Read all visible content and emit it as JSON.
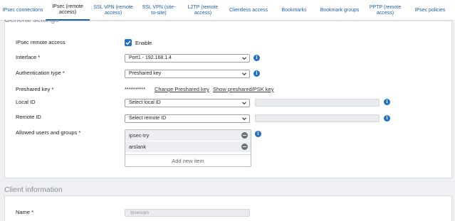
{
  "tabs": [
    {
      "label": "IPsec connections"
    },
    {
      "label": "IPsec (remote access)",
      "active": true
    },
    {
      "label": "SSL VPN (remote access)"
    },
    {
      "label": "SSL VPN (site-to-site)"
    },
    {
      "label": "L2TP (remote access)"
    },
    {
      "label": "Clientless access"
    },
    {
      "label": "Bookmarks"
    },
    {
      "label": "Bookmark groups"
    },
    {
      "label": "PPTP (remote access)"
    },
    {
      "label": "IPsec policies"
    }
  ],
  "general": {
    "section_title": "General settings",
    "ipsec_label": "IPsec remote access",
    "enable_label": "Enable",
    "enable_checked": true,
    "interface_label": "Interface *",
    "interface_value": "Port1 - 192.168.1.4",
    "auth_label": "Authentication type *",
    "auth_value": "Preshared key",
    "psk_label": "Preshared key *",
    "psk_mask": "**********",
    "psk_change": "Change Preshared key",
    "psk_show": "Show preshared/PSK key",
    "local_id_label": "Local ID",
    "local_id_value": "Select local ID",
    "remote_id_label": "Remote ID",
    "remote_id_value": "Select remote ID",
    "allowed_label": "Allowed users and groups *",
    "allowed_items": [
      "ipsec-try",
      "arslank"
    ],
    "add_new": "Add new item"
  },
  "client": {
    "section_title": "Client information",
    "name_label": "Name *",
    "name_placeholder": "Ipsecvpn"
  },
  "colors": {
    "accent": "#1f6fc7",
    "link": "#1f5fa8"
  },
  "icons": {
    "info": "info-icon",
    "chevron": "chevron-down-icon",
    "remove": "remove-icon",
    "check": "check-icon"
  }
}
